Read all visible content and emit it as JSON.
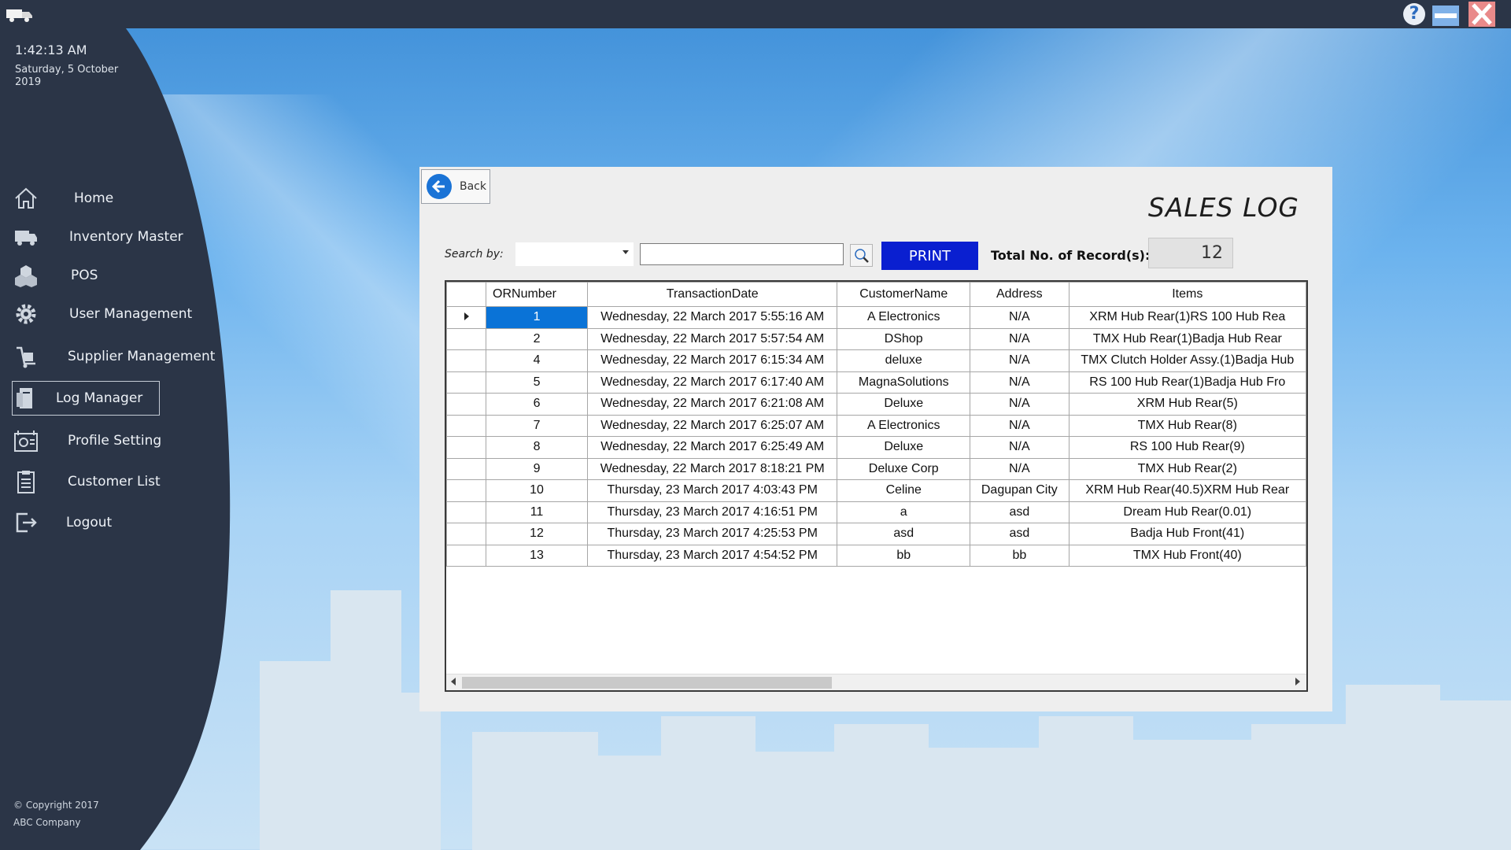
{
  "window": {
    "icons": {
      "app": "truck-icon",
      "help": "help-icon",
      "minimize": "minimize-icon",
      "close": "close-icon"
    }
  },
  "sidebar": {
    "time": "1:42:13 AM",
    "date": "Saturday, 5 October 2019",
    "items": [
      {
        "label": "Home",
        "icon": "home-icon"
      },
      {
        "label": "Inventory Master",
        "icon": "truck-icon"
      },
      {
        "label": "POS",
        "icon": "boxes-icon"
      },
      {
        "label": "User Management",
        "icon": "gear-icon"
      },
      {
        "label": "Supplier Management",
        "icon": "dolly-icon"
      },
      {
        "label": "Log Manager",
        "icon": "log-icon",
        "active": true
      },
      {
        "label": "Profile Setting",
        "icon": "profile-icon"
      },
      {
        "label": "Customer List",
        "icon": "clipboard-icon"
      },
      {
        "label": "Logout",
        "icon": "logout-icon"
      }
    ],
    "copyright_line1": "© Copyright 2017",
    "copyright_line2": "ABC Company"
  },
  "panel": {
    "back_label": "Back",
    "title": "SALES LOG",
    "search_label": "Search by:",
    "search_by_value": "",
    "search_text_value": "",
    "print_label": "PRINT",
    "total_label": "Total No. of Record(s):",
    "total_value": "12"
  },
  "table": {
    "columns": [
      "ORNumber",
      "TransactionDate",
      "CustomerName",
      "Address",
      "Items"
    ],
    "rows": [
      {
        "or": "1",
        "date": "Wednesday, 22 March 2017 5:55:16 AM",
        "customer": "A Electronics",
        "address": "N/A",
        "items": "XRM Hub Rear(1)RS 100 Hub Rea"
      },
      {
        "or": "2",
        "date": "Wednesday, 22 March 2017 5:57:54 AM",
        "customer": "DShop",
        "address": "N/A",
        "items": "TMX Hub Rear(1)Badja Hub Rear"
      },
      {
        "or": "4",
        "date": "Wednesday, 22 March 2017 6:15:34 AM",
        "customer": "deluxe",
        "address": "N/A",
        "items": "TMX Clutch Holder Assy.(1)Badja Hub"
      },
      {
        "or": "5",
        "date": "Wednesday, 22 March 2017 6:17:40 AM",
        "customer": "MagnaSolutions",
        "address": "N/A",
        "items": "RS 100 Hub Rear(1)Badja Hub Fro"
      },
      {
        "or": "6",
        "date": "Wednesday, 22 March 2017 6:21:08 AM",
        "customer": "Deluxe",
        "address": "N/A",
        "items": "XRM Hub Rear(5)"
      },
      {
        "or": "7",
        "date": "Wednesday, 22 March 2017 6:25:07 AM",
        "customer": "A Electronics",
        "address": "N/A",
        "items": "TMX Hub Rear(8)"
      },
      {
        "or": "8",
        "date": "Wednesday, 22 March 2017 6:25:49 AM",
        "customer": "Deluxe",
        "address": "N/A",
        "items": "RS 100 Hub Rear(9)"
      },
      {
        "or": "9",
        "date": "Wednesday, 22 March 2017 8:18:21 PM",
        "customer": "Deluxe Corp",
        "address": "N/A",
        "items": "TMX Hub Rear(2)"
      },
      {
        "or": "10",
        "date": "Thursday, 23 March 2017 4:03:43 PM",
        "customer": "Celine",
        "address": "Dagupan City",
        "items": "XRM Hub Rear(40.5)XRM Hub Rear"
      },
      {
        "or": "11",
        "date": "Thursday, 23 March 2017 4:16:51 PM",
        "customer": "a",
        "address": "asd",
        "items": "Dream Hub Rear(0.01)"
      },
      {
        "or": "12",
        "date": "Thursday, 23 March 2017 4:25:53 PM",
        "customer": "asd",
        "address": "asd",
        "items": "Badja Hub Front(41)"
      },
      {
        "or": "13",
        "date": "Thursday, 23 March 2017 4:54:52 PM",
        "customer": "bb",
        "address": "bb",
        "items": "TMX Hub Front(40)"
      }
    ],
    "selected_row": 0
  },
  "colors": {
    "sidebar": "#2b3547",
    "titlebar": "#2b3547",
    "print_button": "#0a1fd0",
    "selection": "#0a73d7",
    "back_icon": "#1a73d6"
  }
}
